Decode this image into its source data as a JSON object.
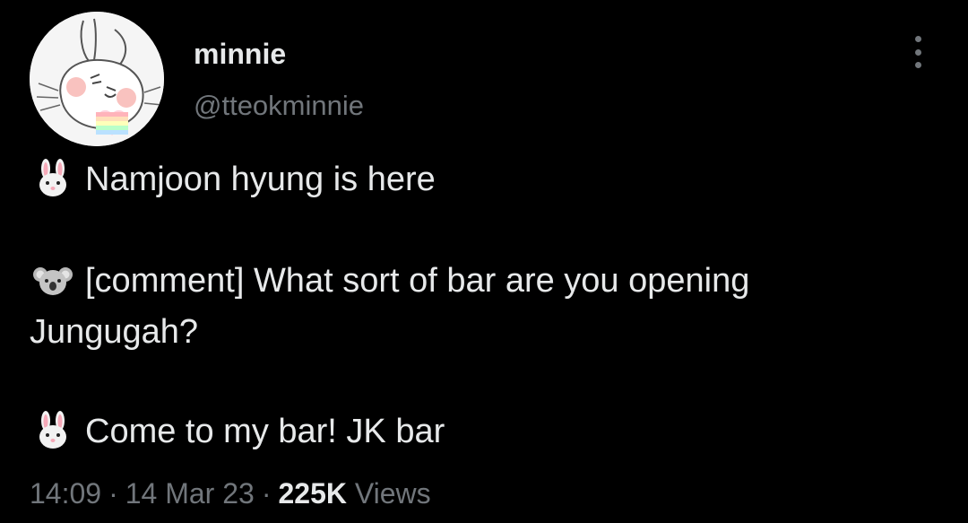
{
  "tweet": {
    "author": {
      "display_name": "minnie",
      "handle": "@tteokminnie"
    },
    "body": {
      "line1": {
        "icon": "rabbit-face-icon",
        "text": "Namjoon hyung is here"
      },
      "line2": {
        "icon": "koala-face-icon",
        "text": "[comment] What sort of bar are you opening"
      },
      "line3": {
        "text": "Jungugah?"
      },
      "line4": {
        "icon": "rabbit-face-icon",
        "text": "Come to my bar! JK bar"
      }
    },
    "meta": {
      "time": "14:09",
      "separator": "·",
      "date": "14 Mar 23",
      "views_count": "225K",
      "views_label": "Views"
    },
    "colors": {
      "background": "#000000",
      "primary_text": "#e7e9ea",
      "secondary_text": "#71767b"
    }
  }
}
